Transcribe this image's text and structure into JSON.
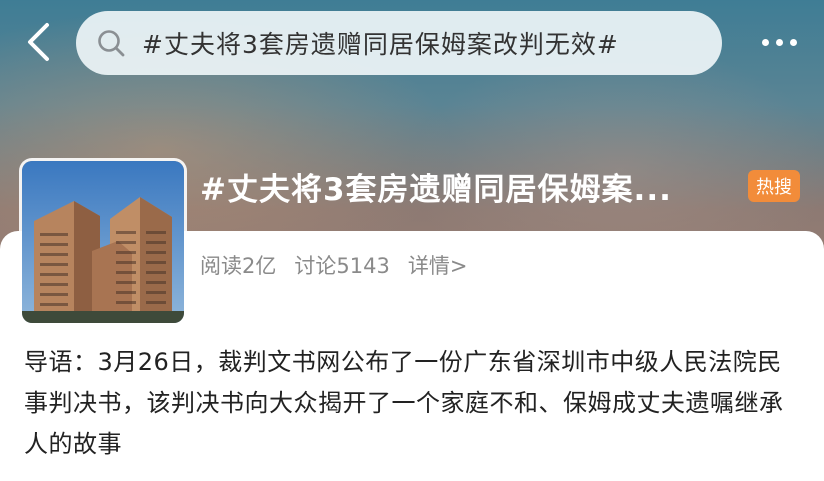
{
  "header": {
    "search_query": "#丈夫将3套房遗赠同居保姆案改判无效#",
    "back_icon": "chevron-left-icon",
    "search_icon": "search-icon",
    "more_icon": "more-dots-icon"
  },
  "topic": {
    "title": "#丈夫将3套房遗赠同居保姆案...",
    "badge": "热搜",
    "badge_color": "#f28c3a",
    "reads": "阅读2亿",
    "discussions": "讨论5143",
    "detail_link": "详情>"
  },
  "intro": {
    "text": "导语：3月26日，裁判文书网公布了一份广东省深圳市中级人民法院民事判决书，该判决书向大众揭开了一个家庭不和、保姆成丈夫遗嘱继承人的故事"
  }
}
